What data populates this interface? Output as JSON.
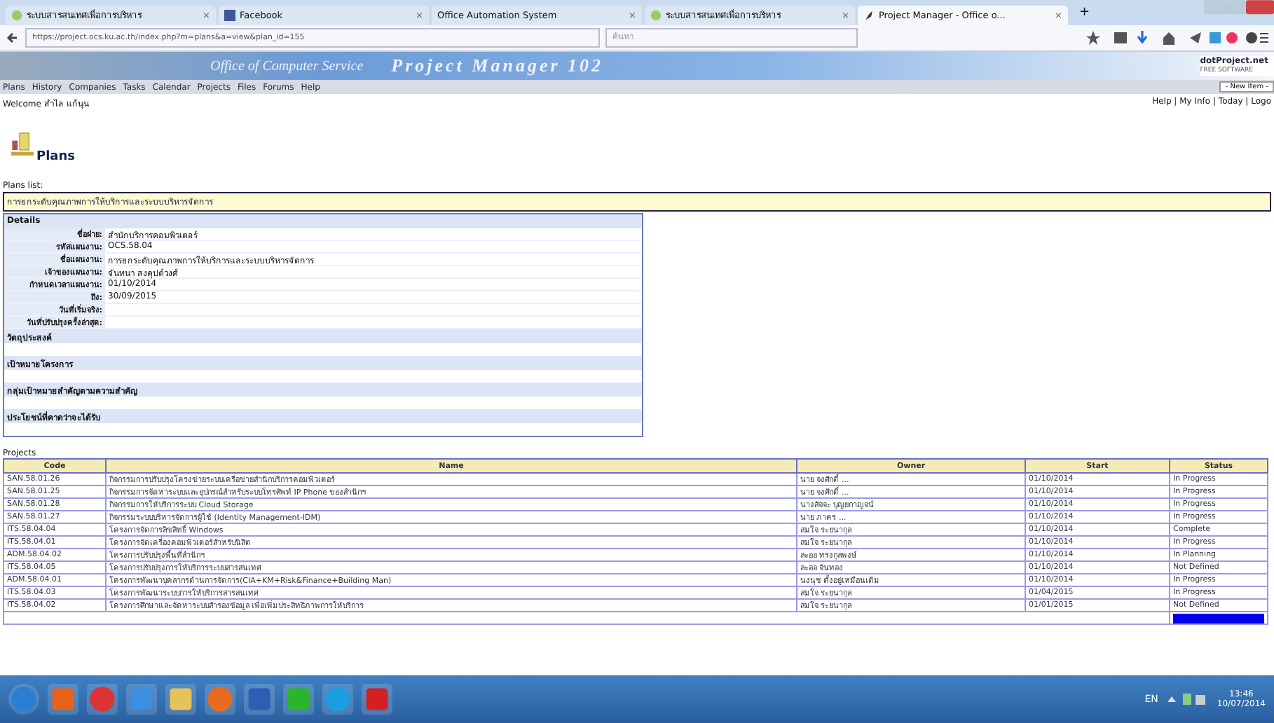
{
  "browser": {
    "tabs": [
      {
        "label": "ระบบสารสนเทศเพื่อการบริหาร",
        "selected": false,
        "kind": "site"
      },
      {
        "label": "Facebook",
        "selected": false,
        "kind": "facebook"
      },
      {
        "label": "Office Automation System",
        "selected": false,
        "kind": "blank"
      },
      {
        "label": "ระบบสารสนเทศเพื่อการบริหาร",
        "selected": false,
        "kind": "site"
      },
      {
        "label": "Project Manager - Office o...",
        "selected": true,
        "kind": "project"
      }
    ],
    "tab_close": "×",
    "new_tab": "+",
    "url": "https://project.ocs.ku.ac.th/index.php?m=plans&a=view&plan_id=155",
    "search": {
      "placeholder": "ค้นหา"
    }
  },
  "header": {
    "org": "Office of Computer Service",
    "title": "Project Manager 102",
    "logo": "dotProject.net",
    "logo_sub": "FREE SOFTWARE"
  },
  "menu": {
    "items": [
      "Plans",
      "History",
      "Companies",
      "Tasks",
      "Calendar",
      "Projects",
      "Files",
      "Forums",
      "Help"
    ],
    "new_item": "- New Item -"
  },
  "welcome": "Welcome สำไล แก้นุน",
  "user_links": "Help | My Info | Today | Logo",
  "page_title": "Plans",
  "plans_label": "Plans list:",
  "plan_name": "การยกระดับคุณภาพการให้บริการและระบบบริหารจัดการ",
  "details": {
    "title": "Details",
    "fields": [
      {
        "label": "ชื่อฝ่าย:",
        "value": "สำนักบริการคอมพิวเตอร์"
      },
      {
        "label": "รหัสแผนงาน:",
        "value": "OCS.58.04"
      },
      {
        "label": "ชื่อแผนงาน:",
        "value": "การยกระดับคุณภาพการให้บริการและระบบบริหารจัดการ"
      },
      {
        "label": "เจ้าของแผนงาน:",
        "value": "จันทนา สงคุปต์วงศ์"
      },
      {
        "label": "กำหนดเวลาแผนงาน:",
        "value": "01/10/2014"
      },
      {
        "label": "ถึง:",
        "value": "30/09/2015"
      },
      {
        "label": "วันที่เริ่มจริง:"
      },
      {
        "label": "วันที่ปรับปรุงครั้งล่าสุด:"
      }
    ],
    "sections": [
      "วัตถุประสงค์",
      "เป้าหมายโครงการ",
      "กลุ่มเป้าหมายสำคัญตามความสำคัญ",
      "ประโยชน์ที่คาดว่าจะได้รับ"
    ]
  },
  "projects": {
    "label": "Projects",
    "columns": [
      "Code",
      "Name",
      "Owner",
      "Start",
      "Status"
    ],
    "rows": [
      [
        "SAN.58.01.26",
        "กิจกรรมการปรับปรุงโครงข่ายระบบเครือข่ายสำนักบริการคอมพิวเตอร์",
        "นาย จงศักดิ์ ...",
        "01/10/2014",
        "In Progress"
      ],
      [
        "SAN.58.01.25",
        "กิจกรรมการจัดหาระบบและอุปกรณ์สำหรับระบบโทรศัพท์ IP Phone ของสำนักฯ",
        "นาย จงศักดิ์ ...",
        "01/10/2014",
        "In Progress"
      ],
      [
        "SAN.58.01.28",
        "กิจกรรมการให้บริการระบบ Cloud Storage",
        "นางสัจจะ บุญยกาญจน์",
        "01/10/2014",
        "In Progress"
      ],
      [
        "SAN.58.01.27",
        "กิจกรรมระบบบริหารจัดการผู้ใช้ (Identity Management-IDM)",
        "นาย ภาคร ...",
        "01/10/2014",
        "In Progress"
      ],
      [
        "ITS.58.04.04",
        "โครงการจัดการลิขสิทธิ์ Windows",
        "สมใจ ระยนากุล",
        "01/10/2014",
        "Complete"
      ],
      [
        "ITS.58.04.01",
        "โครงการจัดเครื่องคอมพิวเตอร์สำหรับนิสิต",
        "สมใจ ระยนากุล",
        "01/10/2014",
        "In Progress"
      ],
      [
        "ADM.58.04.02",
        "โครงการปรับปรุงพื้นที่สำนักฯ",
        "ละออ ทรงกุลพงษ์",
        "01/10/2014",
        "In Planning"
      ],
      [
        "ITS.58.04.05",
        "โครงการปรับปรุงการให้บริการระบบสารสนเทศ",
        "ละออ จันทอง",
        "01/10/2014",
        "Not Defined"
      ],
      [
        "ADM.58.04.01",
        "โครงการพัฒนาบุคลากรด้านการจัดการ(CIA+KM+Risk&Finance+Building Man)",
        "นงนุช ตั้งอยู่เหมือนเดิม",
        "01/10/2014",
        "In Progress"
      ],
      [
        "ITS.58.04.03",
        "โครงการพัฒนาระบบการให้บริการสารสนเทศ",
        "สมใจ ระยนากุล",
        "01/04/2015",
        "In Progress"
      ],
      [
        "ITS.58.04.02",
        "โครงการศึกษาและจัดหาระบบสำรองข้อมูล เพื่อเพิ่มประสิทธิภาพการให้บริการ",
        "สมใจ ระยนากุล",
        "01/01/2015",
        "Not Defined"
      ]
    ]
  },
  "taskbar": {
    "apps": [
      {
        "kind": "orb"
      },
      {
        "kind": "media"
      },
      {
        "kind": "chrome"
      },
      {
        "kind": "ie"
      },
      {
        "kind": "folder"
      },
      {
        "kind": "firefox"
      },
      {
        "kind": "word"
      },
      {
        "kind": "line"
      },
      {
        "kind": "skype"
      },
      {
        "kind": "pdf"
      }
    ],
    "lang": "EN",
    "time": "13:46",
    "date": "10/07/2014"
  }
}
